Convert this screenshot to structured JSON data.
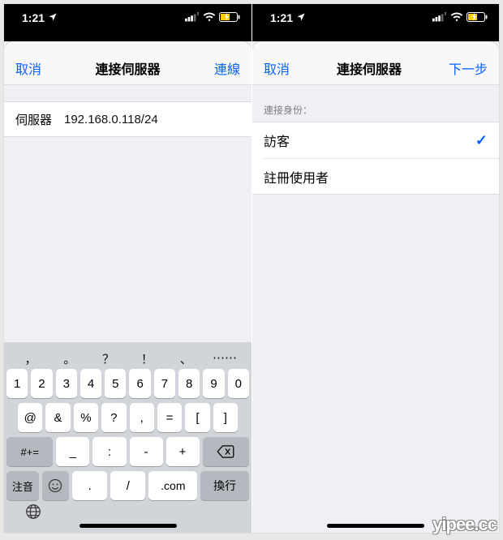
{
  "status": {
    "time": "1:21",
    "loc_glyph": "➤"
  },
  "left": {
    "nav": {
      "cancel": "取消",
      "title": "連接伺服器",
      "action": "連線"
    },
    "form": {
      "server_label": "伺服器",
      "server_value": "192.168.0.118/24"
    },
    "keyboard": {
      "punct": [
        "，",
        "。",
        "？",
        "！",
        "、",
        "⋯⋯"
      ],
      "row_num": [
        "1",
        "2",
        "3",
        "4",
        "5",
        "6",
        "7",
        "8",
        "9",
        "0"
      ],
      "row_sym": [
        "@",
        "&",
        "%",
        "?",
        ",",
        "=",
        "[",
        "]"
      ],
      "row_sym2": [
        "_",
        ":",
        "-",
        "+"
      ],
      "shift_label": "#+=",
      "row_bottom": {
        "mode": "注音",
        "emoji": "☺",
        "period": ".",
        "slash": "/",
        "dotcom": ".com",
        "return": "換行"
      },
      "globe": "🌐"
    }
  },
  "right": {
    "nav": {
      "cancel": "取消",
      "title": "連接伺服器",
      "action": "下一步"
    },
    "section_header": "連接身份：",
    "options": [
      {
        "label": "訪客",
        "selected": true
      },
      {
        "label": "註冊使用者",
        "selected": false
      }
    ]
  },
  "watermark": "yipee.cc"
}
